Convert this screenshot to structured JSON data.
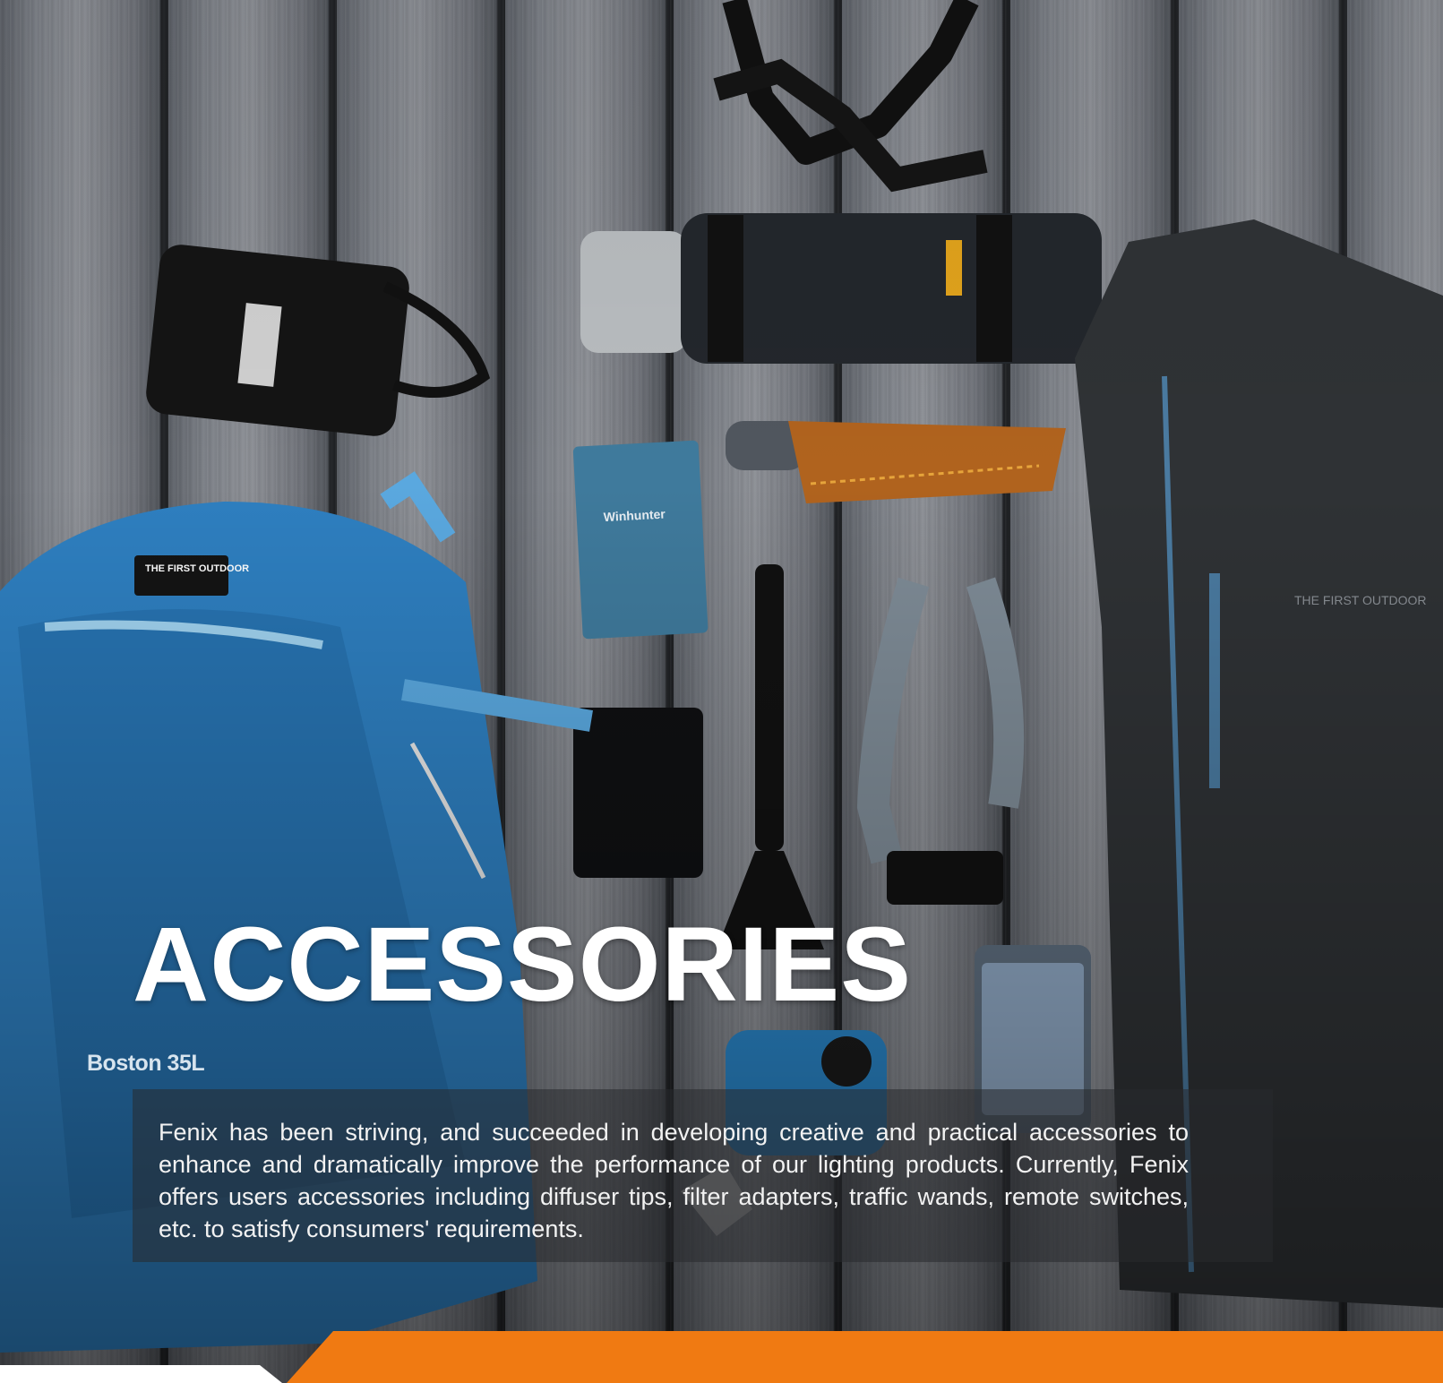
{
  "hero": {
    "title": "ACCESSORIES",
    "description": "Fenix has been striving, and succeeded in developing creative and practical accessories to enhance and dramatically improve the performance of our lighting products. Currently, Fenix offers users accessories including diffuser tips, filter adapters, traffic wands, remote switches, etc. to satisfy consumers' requirements.",
    "backpack_label": "Boston 35L",
    "backpack_patch": "THE FIRST OUTDOOR",
    "notebook_label": "Winhunter",
    "jacket_label": "THE FIRST OUTDOOR"
  },
  "colors": {
    "accent": "#F07A12",
    "title_text": "#FFFFFF",
    "panel": "#282A2E",
    "backpack_blue": "#2E7FC0"
  },
  "icons": {
    "footer_shape": "orange-slanted-band"
  }
}
